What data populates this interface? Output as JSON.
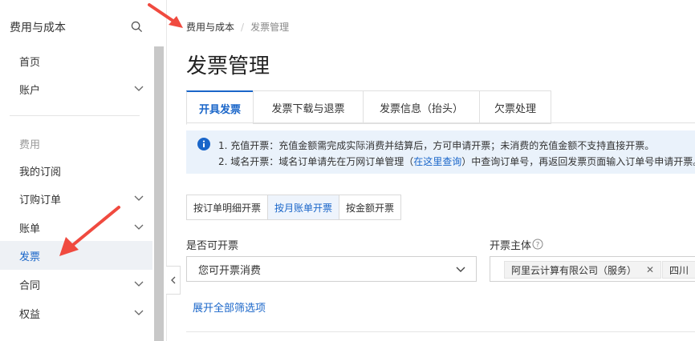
{
  "sidebar": {
    "title": "费用与成本",
    "items": [
      {
        "label": "首页",
        "has_chevron": false
      },
      {
        "label": "账户",
        "has_chevron": true
      },
      {
        "label": "我的订阅",
        "has_chevron": false
      },
      {
        "label": "订购订单",
        "has_chevron": true
      },
      {
        "label": "账单",
        "has_chevron": true
      },
      {
        "label": "发票",
        "has_chevron": false,
        "active": true
      },
      {
        "label": "合同",
        "has_chevron": true
      },
      {
        "label": "权益",
        "has_chevron": true
      }
    ],
    "section_label": "费用"
  },
  "breadcrumb": {
    "root": "费用与成本",
    "sep": "/",
    "current": "发票管理"
  },
  "page": {
    "title": "发票管理"
  },
  "tabs": [
    {
      "label": "开具发票",
      "active": true
    },
    {
      "label": "发票下载与退票"
    },
    {
      "label": "发票信息（抬头）"
    },
    {
      "label": "欠票处理"
    }
  ],
  "notice": {
    "line1": "1. 充值开票：充值金额需完成实际消费并结算后，方可申请开票；未消费的充值金额不支持直接开票。",
    "line2_prefix": "2. 域名开票：域名订单请先在万网订单管理（",
    "line2_link": "在这里查询",
    "line2_suffix": "）中查询订单号，再返回发票页面输入订单号申请开票。"
  },
  "invoice_mode": [
    {
      "label": "按订单明细开票"
    },
    {
      "label": "按月账单开票",
      "active": true
    },
    {
      "label": "按金额开票"
    }
  ],
  "filters": {
    "can_invoice_label": "是否可开票",
    "can_invoice_value": "您可开票消费",
    "entity_label": "开票主体",
    "entity_tags": [
      "阿里云计算有限公司（服务）",
      "四川"
    ],
    "expand_label": "展开全部筛选项"
  },
  "colors": {
    "accent": "#1a66c9",
    "annotation_arrow": "#f04a3f",
    "notice_bg": "#eaf2fb"
  }
}
